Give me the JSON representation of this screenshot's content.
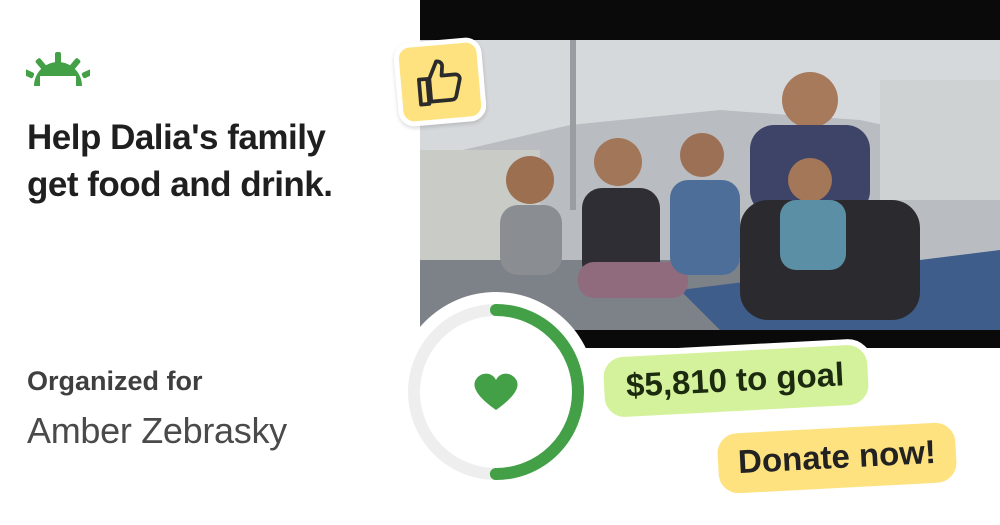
{
  "brand": {
    "logo_icon": "sunrise-logo-icon",
    "accent_color": "#43a047"
  },
  "headline": {
    "line1": "Help Dalia's family",
    "line2": "get food and drink."
  },
  "organizer": {
    "label": "Organized for",
    "name": "Amber Zebrasky"
  },
  "photo": {
    "icon": "family-photo"
  },
  "badge": {
    "icon": "thumbs-up-icon",
    "color": "#fde27f"
  },
  "progress": {
    "fraction": 0.5,
    "ring_color": "#43a047",
    "track_color": "#eeeeee",
    "icon": "heart-icon"
  },
  "goal": {
    "text": "$5,810 to goal",
    "color": "#d4f29b"
  },
  "cta": {
    "label": "Donate now!",
    "color": "#fde27f"
  }
}
